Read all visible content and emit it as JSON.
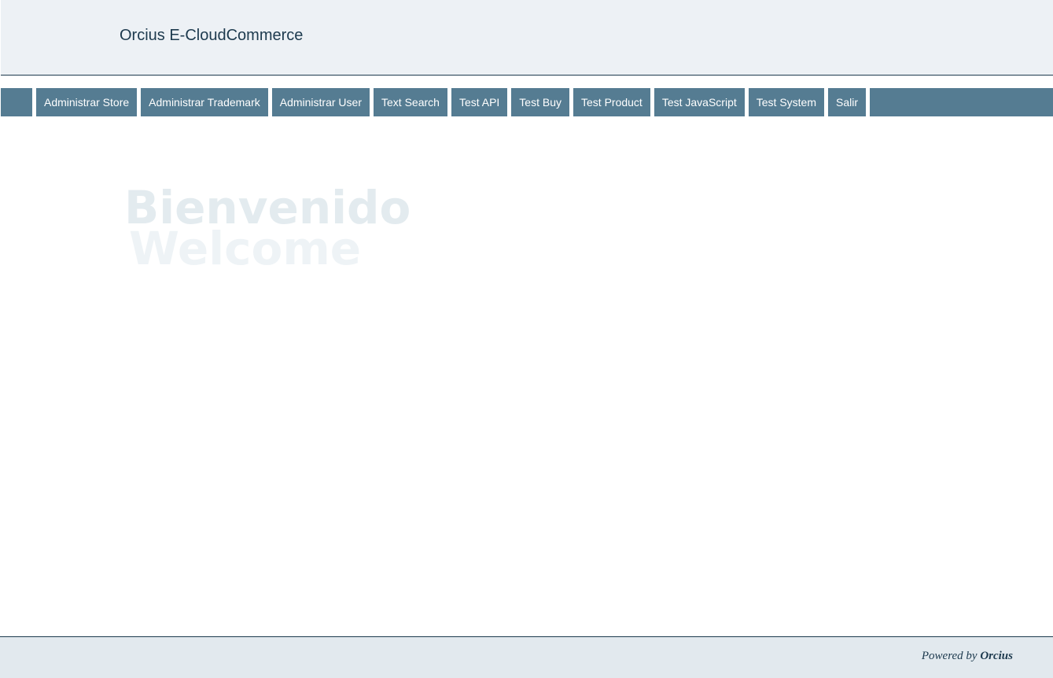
{
  "header": {
    "title": "Orcius E-CloudCommerce"
  },
  "nav": {
    "items": [
      {
        "label": "Administrar Store"
      },
      {
        "label": "Administrar Trademark"
      },
      {
        "label": "Administrar User"
      },
      {
        "label": "Text Search"
      },
      {
        "label": "Test API"
      },
      {
        "label": "Test Buy"
      },
      {
        "label": "Test Product"
      },
      {
        "label": "Test JavaScript"
      },
      {
        "label": "Test System"
      },
      {
        "label": "Salir"
      }
    ]
  },
  "main": {
    "welcome_line1": "Bienvenido",
    "welcome_line2": "Welcome"
  },
  "footer": {
    "powered_prefix": "Powered by",
    "powered_brand": "Orcius"
  },
  "colors": {
    "nav_bg": "#557c92",
    "header_bg": "#edf1f5",
    "footer_bg": "#e2e9ee",
    "text_dark": "#1d3a4e"
  }
}
